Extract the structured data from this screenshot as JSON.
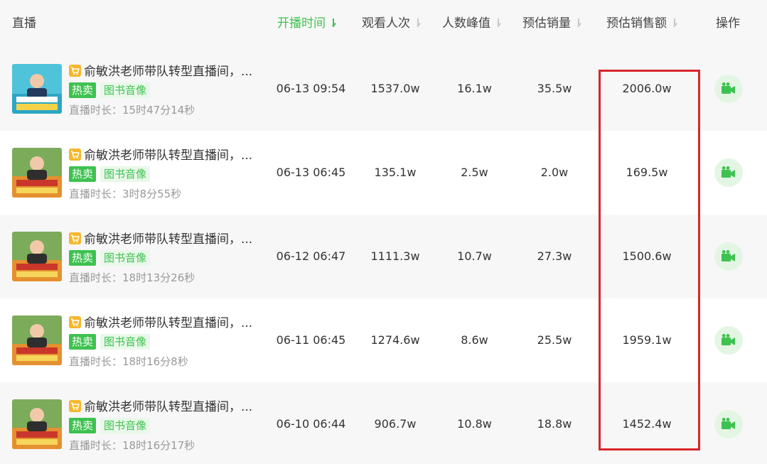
{
  "columns": {
    "live": "直播",
    "start_time": "开播时间",
    "views": "观看人次",
    "peak": "人数峰值",
    "est_sales": "预估销量",
    "est_gmv": "预估销售额",
    "action": "操作"
  },
  "sorted_column": "start_time",
  "colors": {
    "accent": "#3ec24f",
    "highlight_border": "#d9252b",
    "cart_icon": "#f5b72b"
  },
  "rows": [
    {
      "title": "俞敏洪老师带队转型直播间，...",
      "hot_tag": "热卖",
      "category_tag": "图书音像",
      "duration": "直播时长：15时47分14秒",
      "start_time": "06-13 09:54",
      "views": "1537.0w",
      "peak": "16.1w",
      "est_sales": "35.5w",
      "est_gmv": "2006.0w",
      "thumb_style": "blue"
    },
    {
      "title": "俞敏洪老师带队转型直播间，...",
      "hot_tag": "热卖",
      "category_tag": "图书音像",
      "duration": "直播时长：3时8分55秒",
      "start_time": "06-13 06:45",
      "views": "135.1w",
      "peak": "2.5w",
      "est_sales": "2.0w",
      "est_gmv": "169.5w",
      "thumb_style": "green"
    },
    {
      "title": "俞敏洪老师带队转型直播间，...",
      "hot_tag": "热卖",
      "category_tag": "图书音像",
      "duration": "直播时长：18时13分26秒",
      "start_time": "06-12 06:47",
      "views": "1111.3w",
      "peak": "10.7w",
      "est_sales": "27.3w",
      "est_gmv": "1500.6w",
      "thumb_style": "green"
    },
    {
      "title": "俞敏洪老师带队转型直播间，...",
      "hot_tag": "热卖",
      "category_tag": "图书音像",
      "duration": "直播时长：18时16分8秒",
      "start_time": "06-11 06:45",
      "views": "1274.6w",
      "peak": "8.6w",
      "est_sales": "25.5w",
      "est_gmv": "1959.1w",
      "thumb_style": "green"
    },
    {
      "title": "俞敏洪老师带队转型直播间，...",
      "hot_tag": "热卖",
      "category_tag": "图书音像",
      "duration": "直播时长：18时16分17秒",
      "start_time": "06-10 06:44",
      "views": "906.7w",
      "peak": "10.8w",
      "est_sales": "18.8w",
      "est_gmv": "1452.4w",
      "thumb_style": "green"
    }
  ]
}
